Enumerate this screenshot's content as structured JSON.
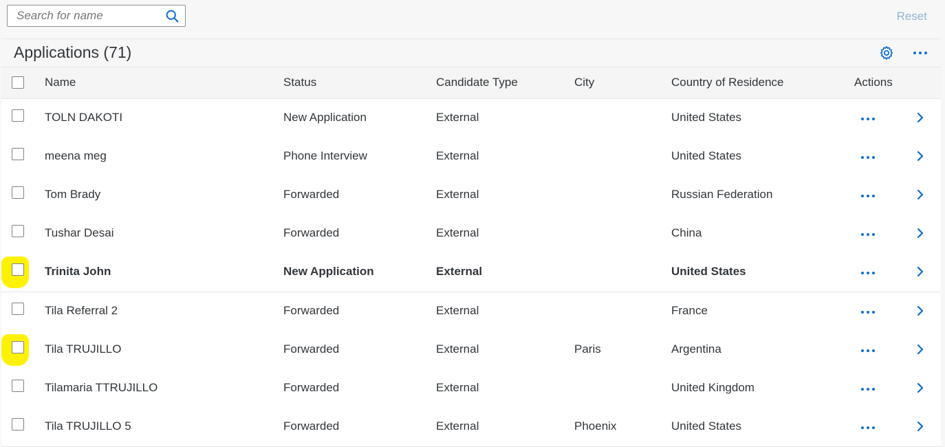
{
  "search": {
    "placeholder": "Search for name"
  },
  "toolbar": {
    "reset_label": "Reset"
  },
  "table": {
    "title": "Applications (71)",
    "columns": [
      "Name",
      "Status",
      "Candidate Type",
      "City",
      "Country of Residence",
      "Actions"
    ],
    "rows": [
      {
        "name": "TOLN DAKOTI",
        "status": "New Application",
        "type": "External",
        "city": "",
        "country": "United States",
        "bold": false,
        "highlighted": false
      },
      {
        "name": "meena meg",
        "status": "Phone Interview",
        "type": "External",
        "city": "",
        "country": "United States",
        "bold": false,
        "highlighted": false
      },
      {
        "name": "Tom Brady",
        "status": "Forwarded",
        "type": "External",
        "city": "",
        "country": "Russian Federation",
        "bold": false,
        "highlighted": false
      },
      {
        "name": "Tushar Desai",
        "status": "Forwarded",
        "type": "External",
        "city": "",
        "country": "China",
        "bold": false,
        "highlighted": false
      },
      {
        "name": "Trinita John",
        "status": "New Application",
        "type": "External",
        "city": "",
        "country": "United States",
        "bold": true,
        "highlighted": true
      },
      {
        "name": "Tila Referral 2",
        "status": "Forwarded",
        "type": "External",
        "city": "",
        "country": "France",
        "bold": false,
        "highlighted": false
      },
      {
        "name": "Tila TRUJILLO",
        "status": "Forwarded",
        "type": "External",
        "city": "Paris",
        "country": "Argentina",
        "bold": false,
        "highlighted": true
      },
      {
        "name": "Tilamaria TTRUJILLO",
        "status": "Forwarded",
        "type": "External",
        "city": "",
        "country": "United Kingdom",
        "bold": false,
        "highlighted": false
      },
      {
        "name": "Tila TRUJILLO 5",
        "status": "Forwarded",
        "type": "External",
        "city": "Phoenix",
        "country": "United States",
        "bold": false,
        "highlighted": false
      }
    ]
  },
  "icons": {
    "search": "search-icon",
    "settings": "gear-icon",
    "more": "more-icon",
    "navigate": "chevron-right-icon"
  },
  "colors": {
    "accent": "#0a6ed1",
    "highlight": "#fff200"
  }
}
